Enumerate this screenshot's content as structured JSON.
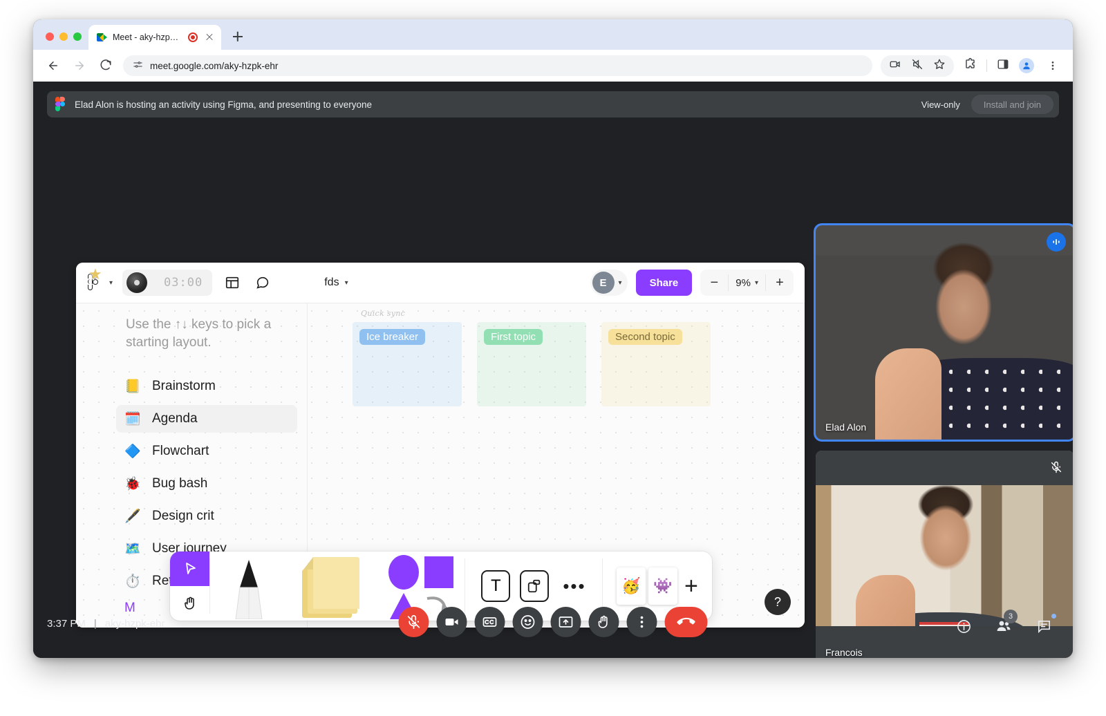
{
  "browser": {
    "tab": {
      "title": "Meet - aky-hzpk-ehr",
      "favicon": "google-meet-favicon",
      "recording_indicator": "record-dot-icon",
      "close": "close-icon"
    },
    "new_tab": "new-tab-icon",
    "nav": {
      "back": "back-arrow-icon",
      "forward": "forward-arrow-icon",
      "reload": "reload-icon"
    },
    "url": "meet.google.com/aky-hzpk-ehr",
    "site_settings_icon": "tune-icon",
    "actions": [
      "camera-icon",
      "sound-muted-icon",
      "bookmark-star-icon",
      "extensions-puzzle-icon",
      "side-panel-icon",
      "profile-avatar-icon"
    ]
  },
  "banner": {
    "icon": "figma-logo-icon",
    "text": "Elad Alon is hosting an activity using Figma, and presenting to everyone",
    "view_only_label": "View-only",
    "install_button_label": "Install and join"
  },
  "figma": {
    "logo": "figma-logo-icon",
    "timer": {
      "value": "03:00",
      "record_icon": "record-disc-icon",
      "star_icon": "star-icon"
    },
    "layout_icon": "layout-panel-icon",
    "comment_icon": "comment-bubble-icon",
    "file_name": "fds",
    "avatar_initial": "E",
    "share_label": "Share",
    "zoom": {
      "minus": "−",
      "level": "9%",
      "plus": "+"
    },
    "canvas": {
      "hint": "Use the ↑↓ keys to pick a starting layout.",
      "layouts": [
        {
          "emoji": "📒",
          "label": "Brainstorm",
          "selected": false
        },
        {
          "emoji": "🗓️",
          "label": "Agenda",
          "selected": true
        },
        {
          "emoji": "🔷",
          "label": "Flowchart",
          "selected": false
        },
        {
          "emoji": "🐞",
          "label": "Bug bash",
          "selected": false
        },
        {
          "emoji": "🖋️",
          "label": "Design crit",
          "selected": false
        },
        {
          "emoji": "🗺️",
          "label": "User journey",
          "selected": false
        },
        {
          "emoji": "⏱️",
          "label": "Retro",
          "selected": false
        }
      ],
      "more_label": "M",
      "board": {
        "title": "Quick sync",
        "columns": [
          {
            "label": "Ice breaker",
            "color": "#8fc0ef"
          },
          {
            "label": "First topic",
            "color": "#93dfb4"
          },
          {
            "label": "Second topic",
            "color": "#f6e09a"
          }
        ]
      }
    },
    "tools": {
      "cursor": "cursor-arrow-icon",
      "hand": "hand-pan-icon",
      "pen": "pen-marker-icon",
      "sticky": "sticky-note-icon",
      "shapes": "shapes-icon",
      "text": "T",
      "frame": "frame-icon",
      "more": "•••",
      "stickers": [
        "sticker-party-face",
        "sticker-green-monster"
      ],
      "add_sticker": "+"
    },
    "help_label": "?"
  },
  "tiles": [
    {
      "name": "Elad Alon",
      "badge": "speaking-indicator-icon",
      "speaking": true
    },
    {
      "name": "Francois",
      "badge": "mic-muted-icon",
      "speaking": false
    }
  ],
  "bottom": {
    "time": "3:37 PM",
    "divider": "|",
    "meeting_code": "aky-hzpk-ehr",
    "controls": [
      {
        "name": "microphone-muted-button",
        "icon": "mic-off-icon",
        "state": "muted"
      },
      {
        "name": "camera-button",
        "icon": "camera-icon",
        "state": "on"
      },
      {
        "name": "captions-button",
        "icon": "cc-icon",
        "state": "off"
      },
      {
        "name": "emoji-reactions-button",
        "icon": "smiley-icon",
        "state": "off"
      },
      {
        "name": "present-screen-button",
        "icon": "present-icon",
        "state": "off"
      },
      {
        "name": "raise-hand-button",
        "icon": "raised-hand-icon",
        "state": "off"
      },
      {
        "name": "more-options-button",
        "icon": "three-dots-vertical-icon",
        "state": "off"
      },
      {
        "name": "leave-call-button",
        "icon": "phone-hangup-icon",
        "state": "danger"
      }
    ],
    "status": {
      "info_icon": "info-circle-icon",
      "people_icon": "people-icon",
      "people_count": "3",
      "chat_icon": "chat-bubble-icon"
    }
  }
}
